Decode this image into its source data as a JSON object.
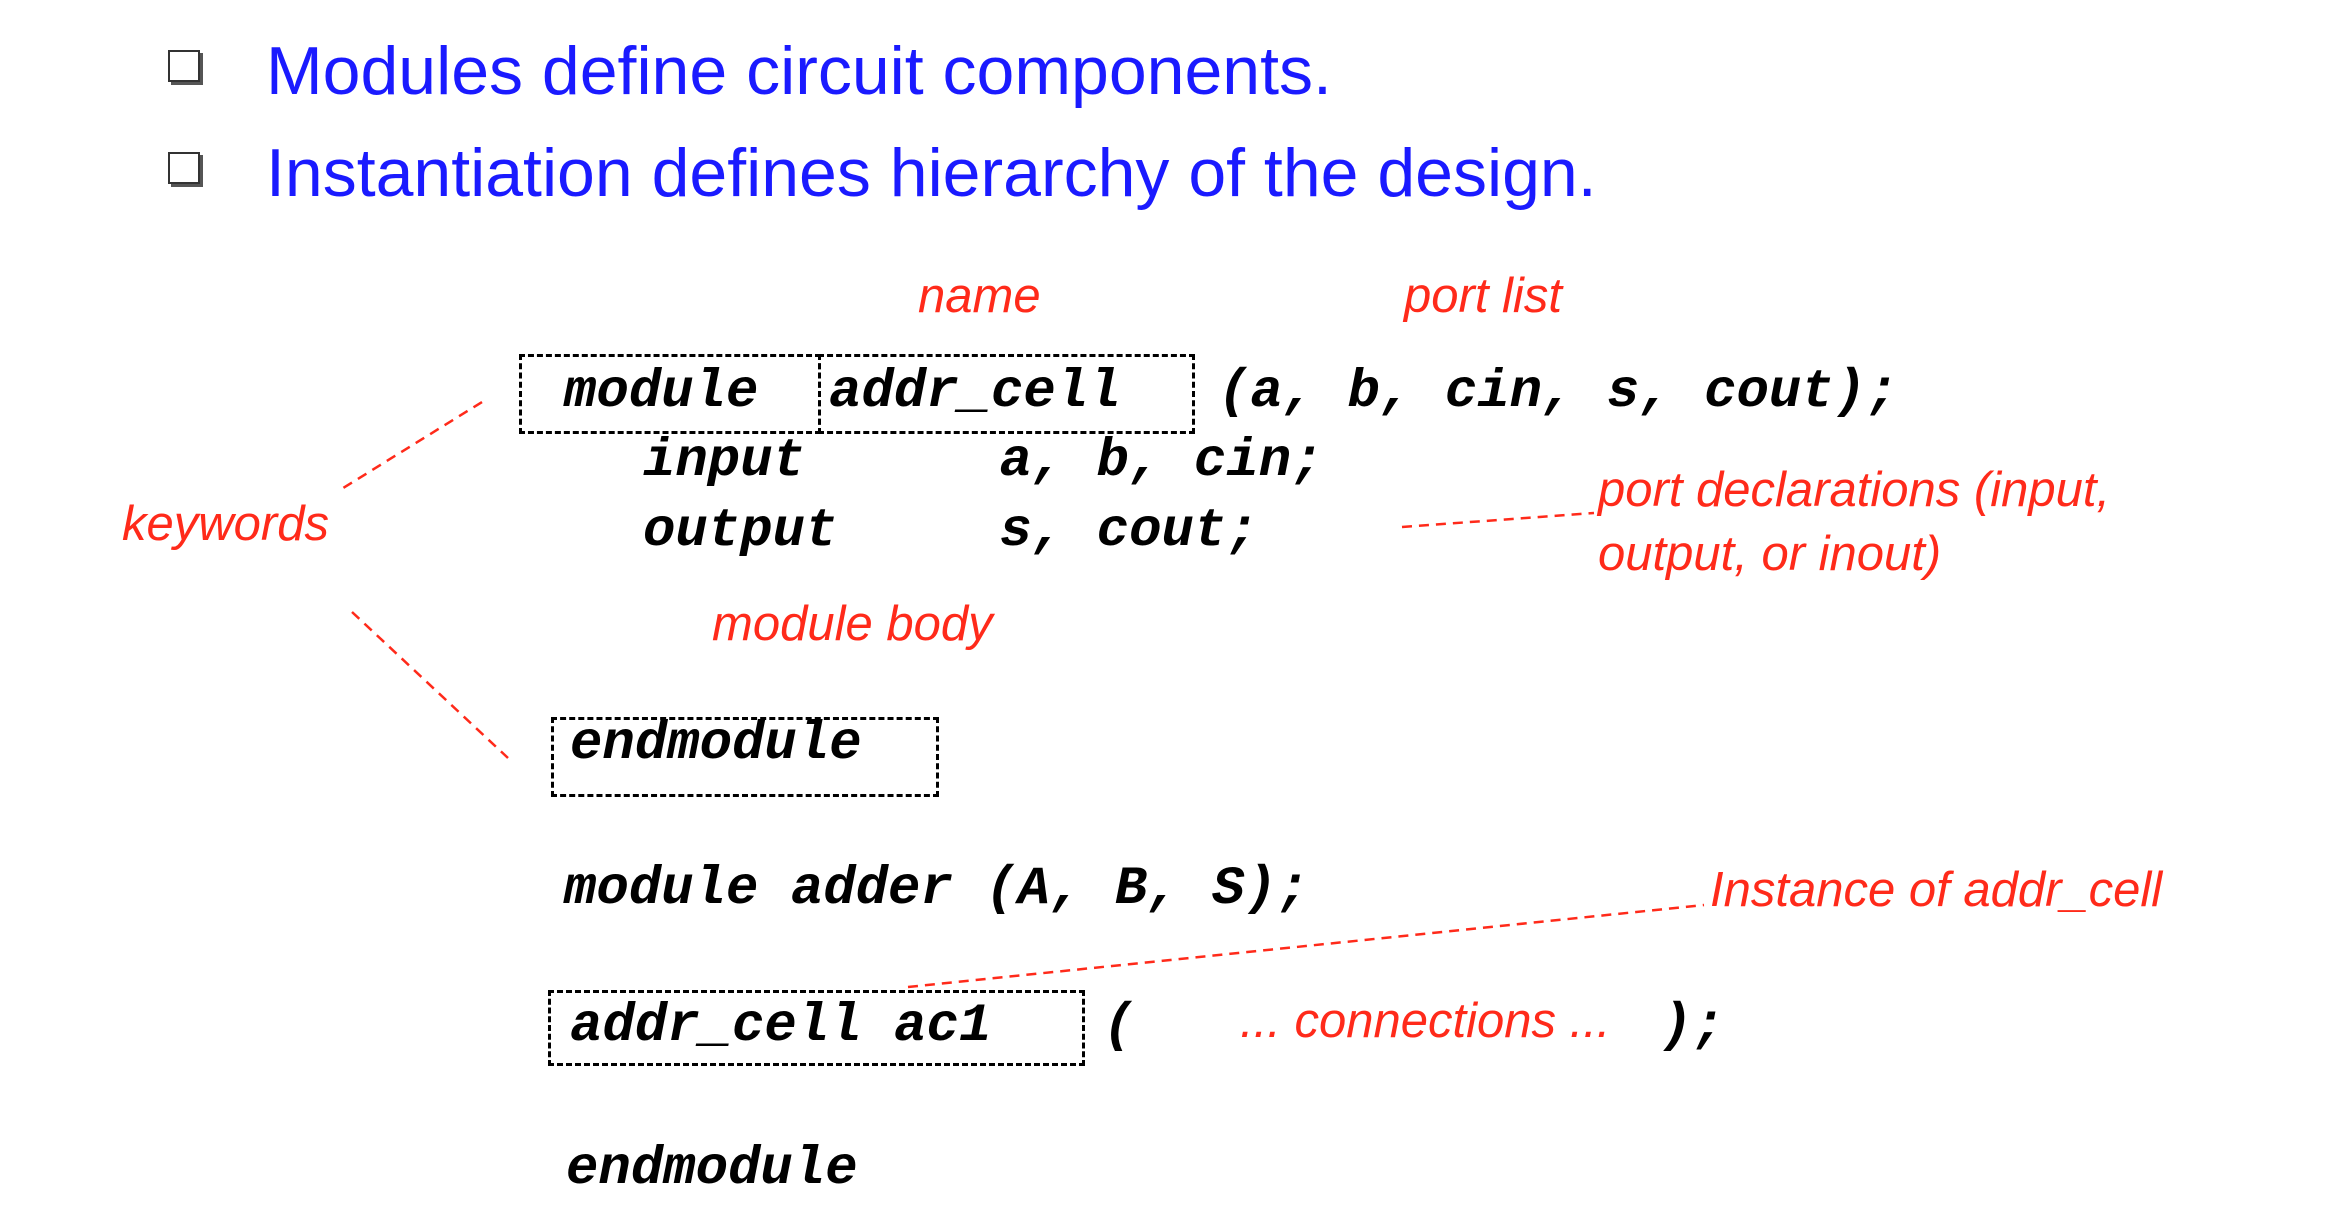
{
  "bullets": [
    "Modules define circuit components.",
    "Instantiation defines hierarchy of the design."
  ],
  "code": {
    "module_kw": "module",
    "cell_name": "addr_cell",
    "port_list": "(a, b, cin, s, cout);",
    "input_line": "input      a, b, cin;",
    "output_line": "output     s, cout;",
    "endmodule1": "endmodule",
    "adder_line": "module adder (A, B, S);",
    "instance": "addr_cell ac1",
    "open_paren": "(",
    "close_paren": ");",
    "endmodule2": "endmodule"
  },
  "annotations": {
    "name": "name",
    "port_list": "port list",
    "keywords": "keywords",
    "port_decl_line1": "port declarations (input,",
    "port_decl_line2": "output, or inout)",
    "module_body": "module body",
    "instance_of": "Instance of addr_cell",
    "connections": "... connections ..."
  },
  "colors": {
    "bullet_text": "#1a1aff",
    "annotation": "#ff2a1a",
    "code": "#000000"
  }
}
